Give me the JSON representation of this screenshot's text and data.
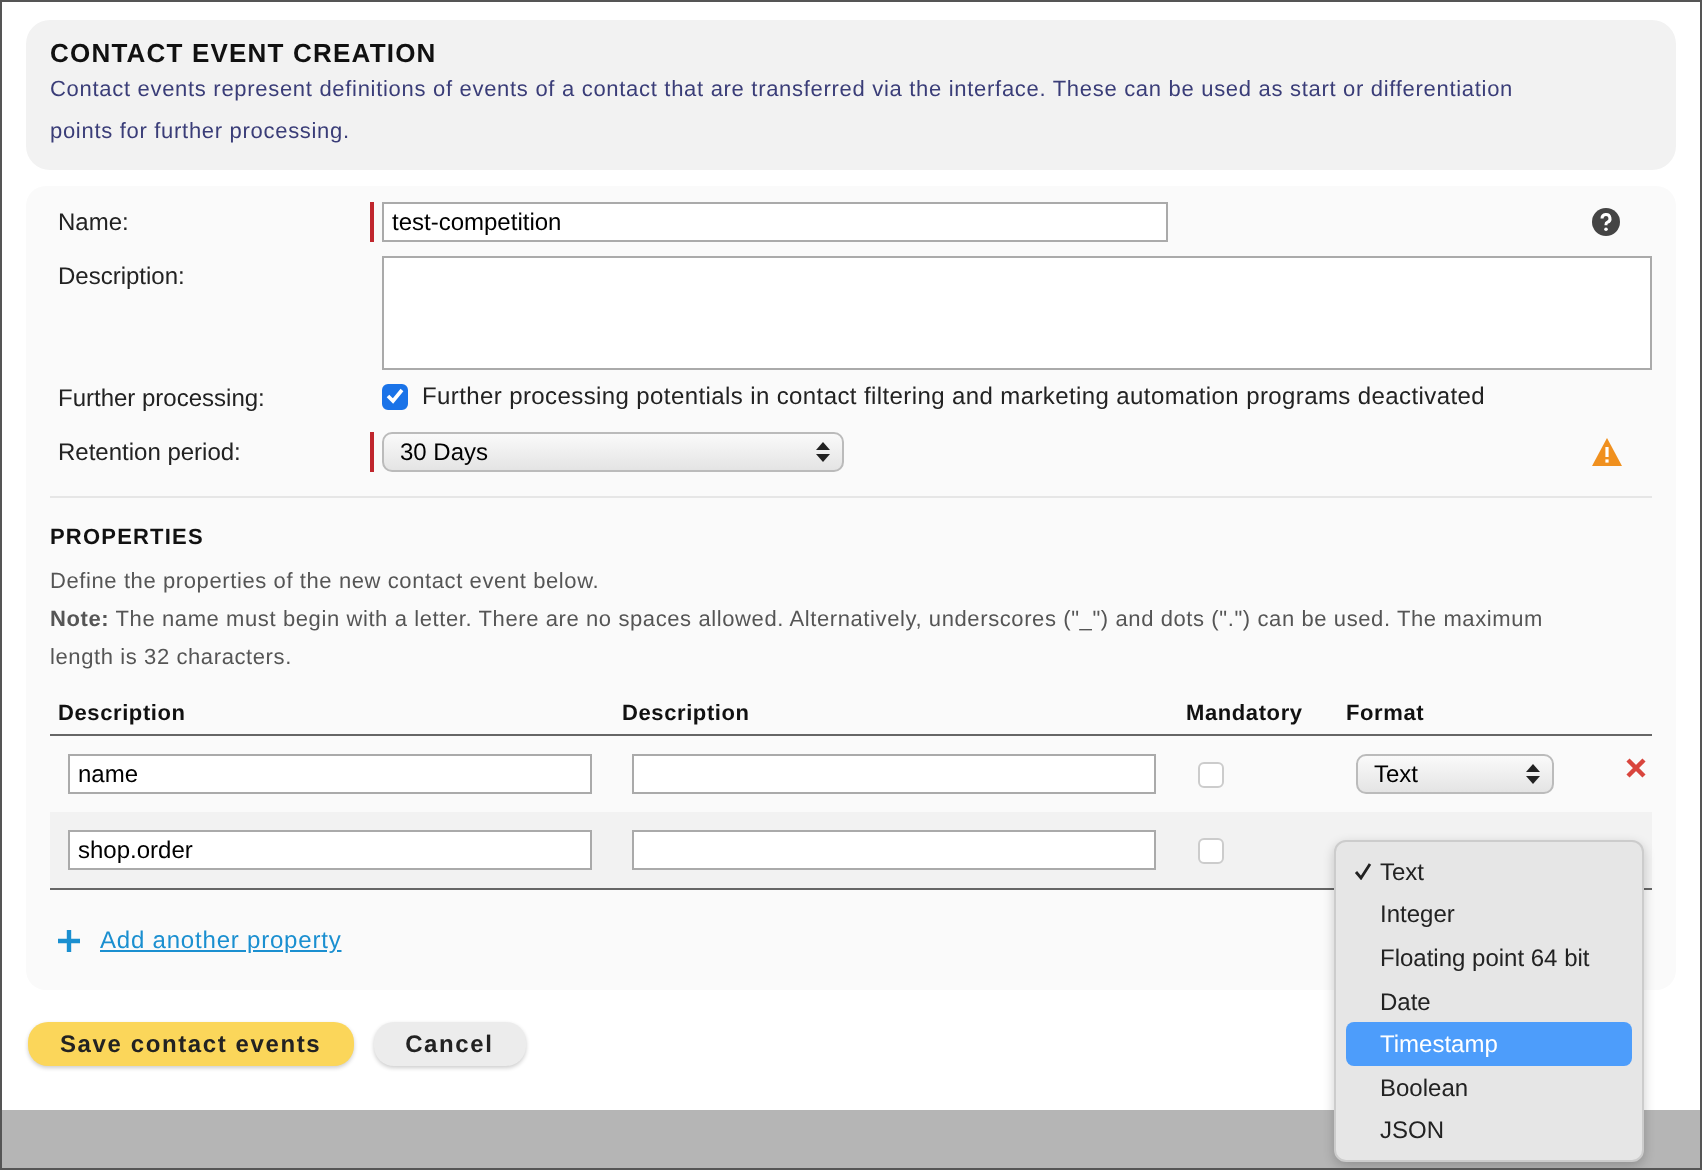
{
  "header": {
    "title": "CONTACT EVENT CREATION",
    "description": "Contact events represent definitions of events of a contact that are transferred via the interface. These can be used as start or differentiation points for further processing."
  },
  "form": {
    "name": {
      "label": "Name:",
      "value": "test-competition",
      "required": true
    },
    "description": {
      "label": "Description:"
    },
    "further_processing": {
      "label": "Further processing:",
      "checked": true,
      "text": "Further processing potentials in contact filtering and marketing automation programs deactivated"
    },
    "retention": {
      "label": "Retention period:",
      "value": "30 Days",
      "required": true
    }
  },
  "properties": {
    "title": "PROPERTIES",
    "intro": "Define the properties of the new contact event below.",
    "note": "**Note:** The name must begin with a letter. There are no spaces allowed. Alternatively, underscores (\"_\") and dots (\".\") can be used. The maximum length is 32 characters.",
    "columns": [
      "Description",
      "Description",
      "Mandatory",
      "Format"
    ],
    "rows": [
      {
        "name": "name",
        "mandatory": false,
        "format": "Text"
      },
      {
        "name": "shop.order",
        "mandatory": false
      }
    ],
    "add_link": "Add another property"
  },
  "format_menu": [
    {
      "label": "Text",
      "checked": true,
      "highlighted": false
    },
    {
      "label": "Integer",
      "checked": false,
      "highlighted": false
    },
    {
      "label": "Floating point 64 bit",
      "checked": false,
      "highlighted": false
    },
    {
      "label": "Date",
      "checked": false,
      "highlighted": false
    },
    {
      "label": "Timestamp",
      "checked": false,
      "highlighted": true
    },
    {
      "label": "Boolean",
      "checked": false,
      "highlighted": false
    },
    {
      "label": "JSON",
      "checked": false,
      "highlighted": false
    }
  ],
  "buttons": {
    "save": "Save contact events",
    "cancel": "Cancel"
  }
}
